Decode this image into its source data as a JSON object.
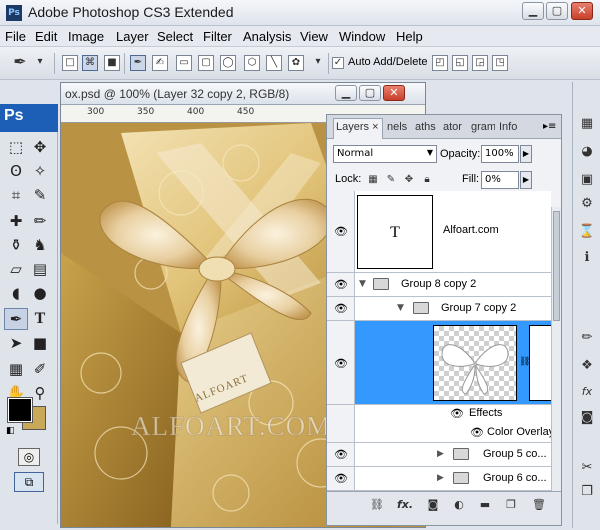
{
  "window": {
    "title": "Adobe Photoshop CS3 Extended",
    "logo": "Ps"
  },
  "menu": [
    "File",
    "Edit",
    "Image",
    "Layer",
    "Select",
    "Filter",
    "Analysis",
    "View",
    "Window",
    "Help"
  ],
  "options_bar": {
    "auto_add_delete_label": "Auto Add/Delete",
    "auto_add_delete_checked": true
  },
  "tools_panel": {
    "logo": "Ps",
    "type_tool": "T"
  },
  "document": {
    "title": "ox.psd @ 100% (Layer 32 copy 2, RGB/8)",
    "ruler_ticks": [
      "300",
      "350",
      "400",
      "450"
    ],
    "watermark": "ALFOART.COM",
    "tag_text": "ALFOART"
  },
  "layers_panel": {
    "tabs": [
      "Layers",
      "nels",
      "aths",
      "ator",
      "gram",
      "Info"
    ],
    "tab_close": "×",
    "blend_mode": "Normal",
    "opacity_label": "Opacity:",
    "opacity_value": "100%",
    "lock_label": "Lock:",
    "fill_label": "Fill:",
    "fill_value": "0%",
    "rows": {
      "text_layer_thumb": "T",
      "text_layer_name": "Alfoart.com",
      "group_8": "Group 8 copy 2",
      "group_7": "Group 7 copy 2",
      "effects": "Effects",
      "color_overlay": "Color Overlay",
      "group_5": "Group 5 co...",
      "group_6": "Group 6 co..."
    },
    "bottom_fx": "fx."
  },
  "colors": {
    "selection_blue": "#3399ff",
    "panel_blue": "#1d5fb6",
    "foreground": "#000000",
    "background_color": "#c9a85a"
  }
}
